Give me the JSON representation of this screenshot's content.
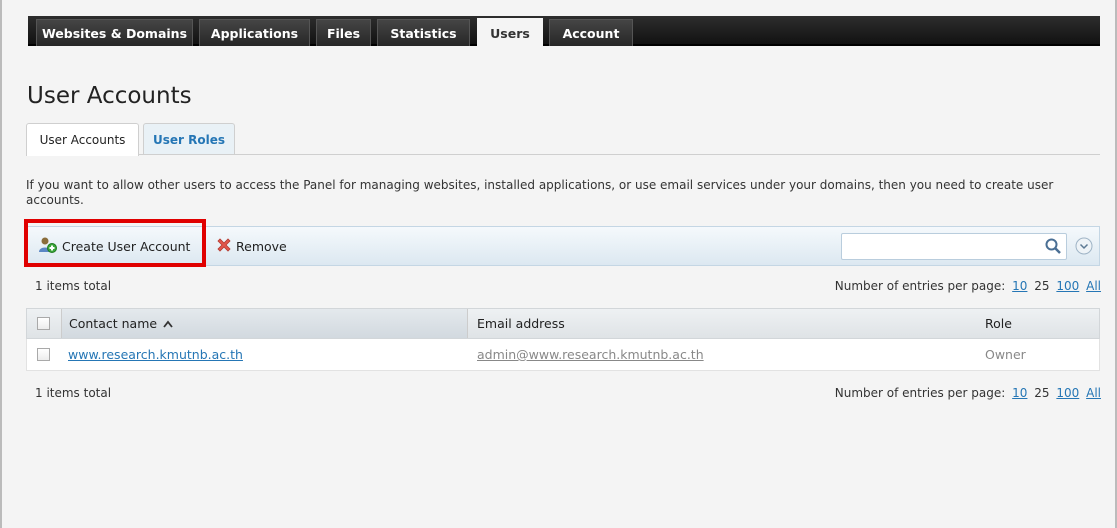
{
  "nav": {
    "tabs": [
      {
        "label": "Websites & Domains"
      },
      {
        "label": "Applications"
      },
      {
        "label": "Files"
      },
      {
        "label": "Statistics"
      },
      {
        "label": "Users"
      },
      {
        "label": "Account"
      }
    ],
    "active": "Users"
  },
  "page": {
    "title": "User Accounts",
    "subtabs": [
      {
        "label": "User Accounts"
      },
      {
        "label": "User Roles"
      }
    ],
    "description": "If you want to allow other users to access the Panel for managing websites, installed applications, or use email services under your domains, then you need to create user accounts."
  },
  "toolbar": {
    "create_label": "Create User Account",
    "remove_label": "Remove",
    "search_placeholder": ""
  },
  "list": {
    "total_label": "1 items total",
    "perpage_label": "Number of entries per page:",
    "perpage_options": [
      "10",
      "25",
      "100",
      "All"
    ],
    "perpage_current": "25",
    "columns": {
      "contact": "Contact name",
      "email": "Email address",
      "role": "Role"
    },
    "rows": [
      {
        "contact": "www.research.kmutnb.ac.th",
        "email": "admin@www.research.kmutnb.ac.th",
        "role": "Owner"
      }
    ]
  },
  "colors": {
    "link": "#2576b5",
    "highlight": "#e00000",
    "nav_bg": "#1a1a1a"
  }
}
